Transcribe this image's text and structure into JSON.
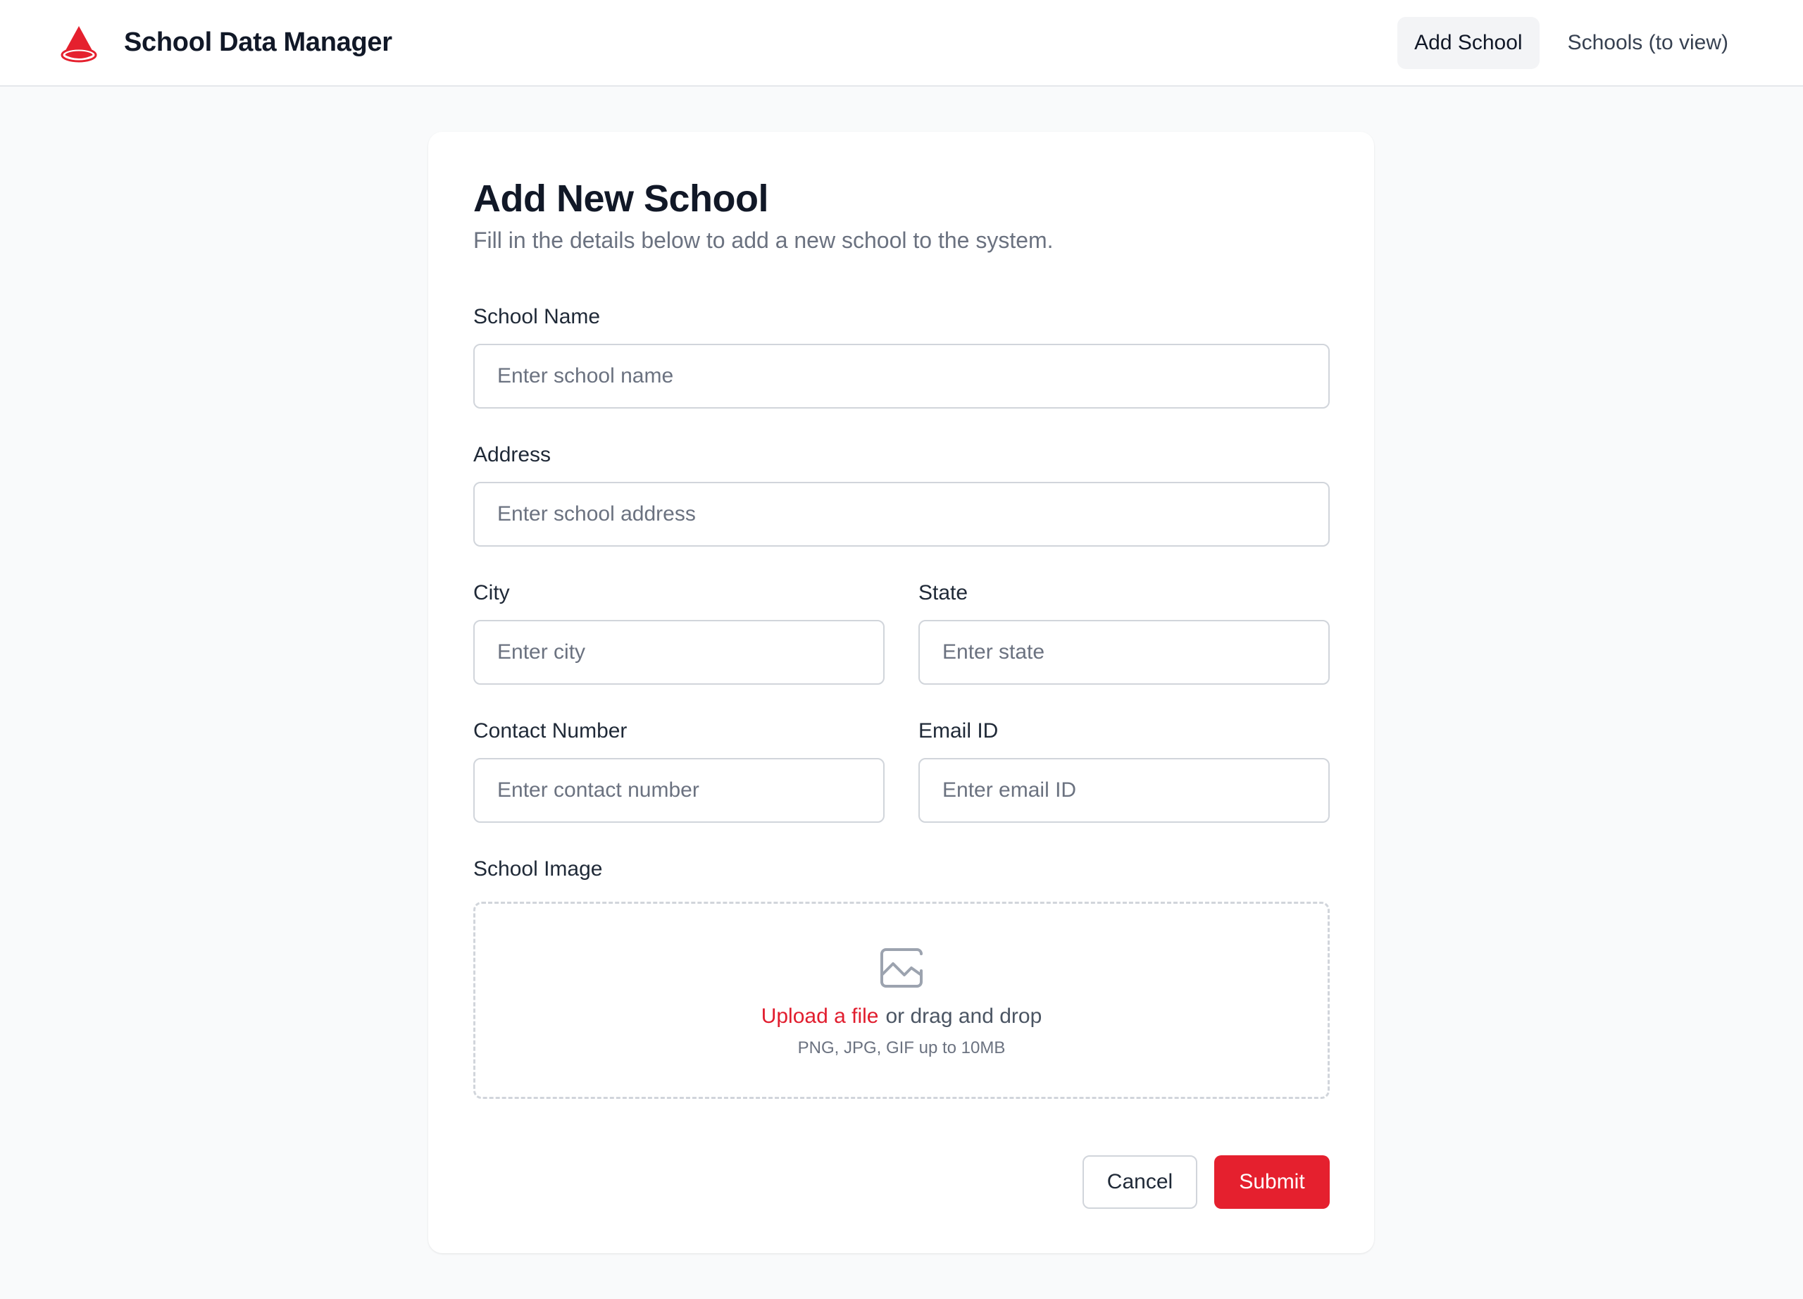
{
  "app": {
    "title": "School Data Manager",
    "brand_color": "#e5202e",
    "logo_icon": "cone-icon"
  },
  "nav": {
    "items": [
      {
        "label": "Add School",
        "active": true
      },
      {
        "label": "Schools (to view)",
        "active": false
      }
    ]
  },
  "form": {
    "title": "Add New School",
    "subtitle": "Fill in the details below to add a new school to the system.",
    "fields": {
      "school_name": {
        "label": "School Name",
        "placeholder": "Enter school name",
        "value": ""
      },
      "address": {
        "label": "Address",
        "placeholder": "Enter school address",
        "value": ""
      },
      "city": {
        "label": "City",
        "placeholder": "Enter city",
        "value": ""
      },
      "state": {
        "label": "State",
        "placeholder": "Enter state",
        "value": ""
      },
      "contact": {
        "label": "Contact Number",
        "placeholder": "Enter contact number",
        "value": ""
      },
      "email": {
        "label": "Email ID",
        "placeholder": "Enter email ID",
        "value": ""
      }
    },
    "image": {
      "label": "School Image",
      "icon": "image-icon",
      "upload_link": "Upload a file",
      "drag_text": "or drag and drop",
      "hint": "PNG, JPG, GIF up to 10MB"
    },
    "actions": {
      "cancel": "Cancel",
      "submit": "Submit"
    }
  }
}
